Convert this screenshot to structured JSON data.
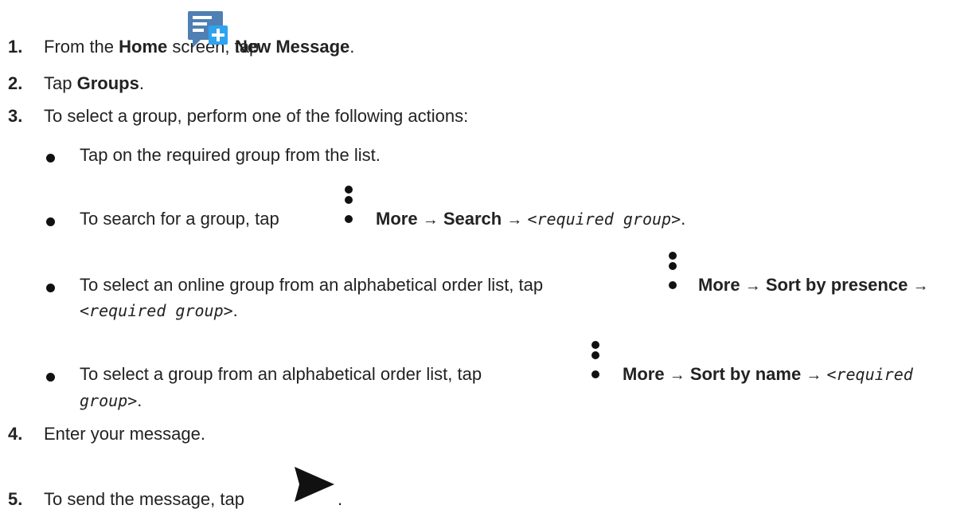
{
  "steps": [
    {
      "number": "1.",
      "prefix": "From the ",
      "home": "Home",
      "mid": " screen, tap ",
      "action": "New Message",
      "suffix": ".",
      "icon": "new-message-icon"
    },
    {
      "number": "2.",
      "prefix": "Tap ",
      "action": "Groups",
      "suffix": "."
    },
    {
      "number": "3.",
      "text": "To select a group, perform one of the following actions:"
    },
    {
      "number": "4.",
      "text": "Enter your message."
    },
    {
      "number": "5.",
      "text": "To send the message, tap",
      "suffix": ".",
      "icon": "send-icon"
    }
  ],
  "bullets": [
    {
      "text": "Tap on the required group from the list."
    },
    {
      "prefix": "To search for a group, tap",
      "more": "More",
      "arrow": "→",
      "action": "Search",
      "arrow2": "→",
      "target": "<required group>",
      "suffix": ".",
      "icon": "more-vert-icon"
    },
    {
      "prefix": "To select an online group from an alphabetical order list, tap",
      "more": "More",
      "arrow": "→",
      "action": "Sort by presence",
      "arrow2": "→",
      "target": "<required group>",
      "suffix": ".",
      "icon": "more-vert-icon"
    },
    {
      "prefix": "To select a group from an alphabetical order list, tap",
      "more": "More",
      "arrow": "→",
      "action": "Sort by name",
      "arrow2": "→",
      "target_line1": "<required",
      "target_line2": "group>",
      "suffix": ".",
      "icon": "more-vert-icon"
    }
  ],
  "colors": {
    "text": "#222222",
    "icon_blue": "#2a8ad4",
    "icon_dark": "#111111"
  }
}
